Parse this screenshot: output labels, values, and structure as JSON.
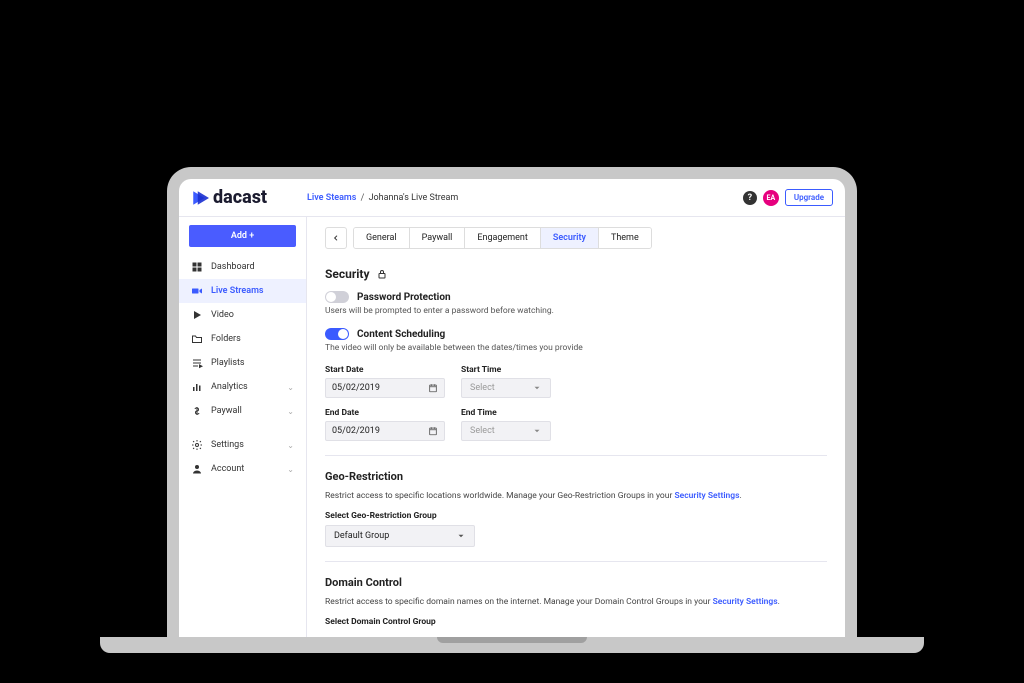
{
  "brand": "dacast",
  "breadcrumb": {
    "root": "Live Steams",
    "current": "Johanna's Live Stream"
  },
  "topbar": {
    "avatar_initials": "EA",
    "upgrade_label": "Upgrade"
  },
  "sidebar": {
    "add_label": "Add +",
    "items": [
      {
        "label": "Dashboard"
      },
      {
        "label": "Live Streams"
      },
      {
        "label": "Video"
      },
      {
        "label": "Folders"
      },
      {
        "label": "Playlists"
      },
      {
        "label": "Analytics"
      },
      {
        "label": "Paywall"
      }
    ],
    "bottom_items": [
      {
        "label": "Settings"
      },
      {
        "label": "Account"
      }
    ]
  },
  "tabs": {
    "items": [
      "General",
      "Paywall",
      "Engagement",
      "Security",
      "Theme"
    ],
    "active_index": 3
  },
  "security": {
    "heading": "Security",
    "password": {
      "title": "Password Protection",
      "hint": "Users will be prompted to enter a password before watching."
    },
    "scheduling": {
      "title": "Content Scheduling",
      "hint": "The video will only be available between the dates/times you provide",
      "start_date_label": "Start Date",
      "start_time_label": "Start Time",
      "end_date_label": "End Date",
      "end_time_label": "End Time",
      "start_date_value": "05/02/2019",
      "end_date_value": "05/02/2019",
      "time_placeholder": "Select"
    },
    "geo": {
      "heading": "Geo-Restriction",
      "desc_prefix": "Restrict access to specific locations worldwide. Manage your Geo-Restriction Groups in your ",
      "desc_link": "Security Settings",
      "select_label": "Select Geo-Restriction Group",
      "selected_value": "Default Group"
    },
    "domain": {
      "heading": "Domain Control",
      "desc_prefix": "Restrict access to specific domain names on the internet. Manage your Domain Control Groups in your ",
      "desc_link": "Security Settings",
      "select_label": "Select Domain Control Group"
    }
  }
}
